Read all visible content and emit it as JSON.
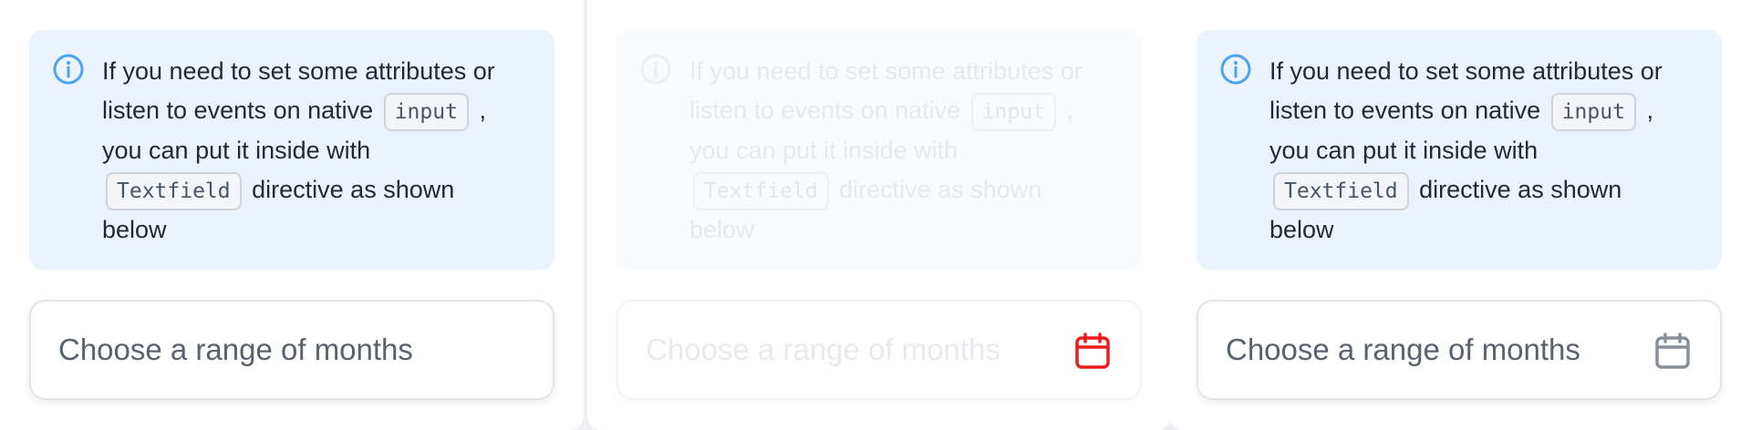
{
  "colors": {
    "info_icon": "#4da3f3",
    "alert_bg": "#eaf3fe",
    "calendar_active": "#ef1c1c",
    "calendar_default": "#8a909a",
    "disabled_icon": "#eceef1"
  },
  "panels": [
    {
      "state": "default",
      "alert": {
        "icon": "info-circle-icon",
        "text_1": "If you need to set some attributes or listen to events on native",
        "code_1": "input",
        "text_2": ", you can put it inside with",
        "code_2": "Textfield",
        "text_3": "directive as shown below"
      },
      "field": {
        "placeholder": "Choose a range of months",
        "icon": ""
      }
    },
    {
      "state": "disabled",
      "alert": {
        "icon": "info-circle-icon",
        "text_1": "If you need to set some attributes or listen to events on native",
        "code_1": "input",
        "text_2": ", you can put it inside with",
        "code_2": "Textfield",
        "text_3": "directive as shown below"
      },
      "field": {
        "placeholder": "Choose a range of months",
        "icon": "calendar-icon"
      }
    },
    {
      "state": "default-with-icon",
      "alert": {
        "icon": "info-circle-icon",
        "text_1": "If you need to set some attributes or listen to events on native",
        "code_1": "input",
        "text_2": ", you can put it inside with",
        "code_2": "Textfield",
        "text_3": "directive as shown below"
      },
      "field": {
        "placeholder": "Choose a range of months",
        "icon": "calendar-icon"
      }
    }
  ]
}
